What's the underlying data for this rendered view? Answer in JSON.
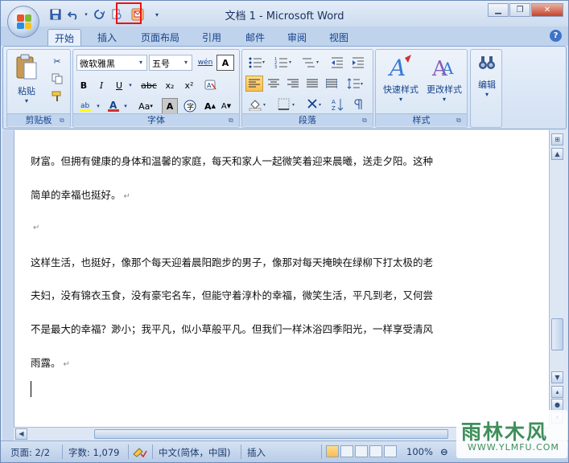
{
  "window": {
    "title": "文档 1 - Microsoft Word"
  },
  "qat": {
    "items": [
      "save-icon",
      "undo-icon",
      "redo-icon",
      "print-preview-icon",
      "email-icon",
      "customize-icon"
    ]
  },
  "tabs": [
    "开始",
    "插入",
    "页面布局",
    "引用",
    "邮件",
    "审阅",
    "视图"
  ],
  "ribbon": {
    "clipboard": {
      "label": "剪贴板",
      "paste": "粘贴"
    },
    "font": {
      "label": "字体",
      "font_name": "微软雅黑",
      "font_size": "五号",
      "bold": "B",
      "italic": "I",
      "underline": "U",
      "strike": "abc",
      "sub": "x₂",
      "sup": "x²",
      "change_case": "Aa",
      "grow": "A",
      "shrink": "A",
      "wen": "wén"
    },
    "paragraph": {
      "label": "段落"
    },
    "styles": {
      "label": "样式",
      "quick_styles": "快速样式",
      "change_styles": "更改样式"
    },
    "editing": {
      "label": "编辑"
    }
  },
  "document": {
    "lines": [
      "财富。但拥有健康的身体和温馨的家庭，每天和家人一起微笑着迎来晨曦，送走夕阳。这种",
      "简单的幸福也挺好。",
      "",
      "这样生活，也挺好，像那个每天迎着晨阳跑步的男子，像那对每天掩映在绿柳下打太极的老",
      "夫妇，没有锦衣玉食，没有豪宅名车，但能守着淳朴的幸福，微笑生活，平凡到老，又何尝",
      "不是最大的幸福？渺小；我平凡，似小草般平凡。但我们一样沐浴四季阳光，一样享受清风",
      "雨露。"
    ],
    "paragraph_mark": "↵"
  },
  "status": {
    "page": "页面: 2/2",
    "words": "字数: 1,079",
    "language": "中文(简体，中国)",
    "mode": "插入",
    "zoom": "100%"
  },
  "watermark": {
    "main": "雨林木风",
    "sub": "WWW.YLMFU.COM"
  }
}
